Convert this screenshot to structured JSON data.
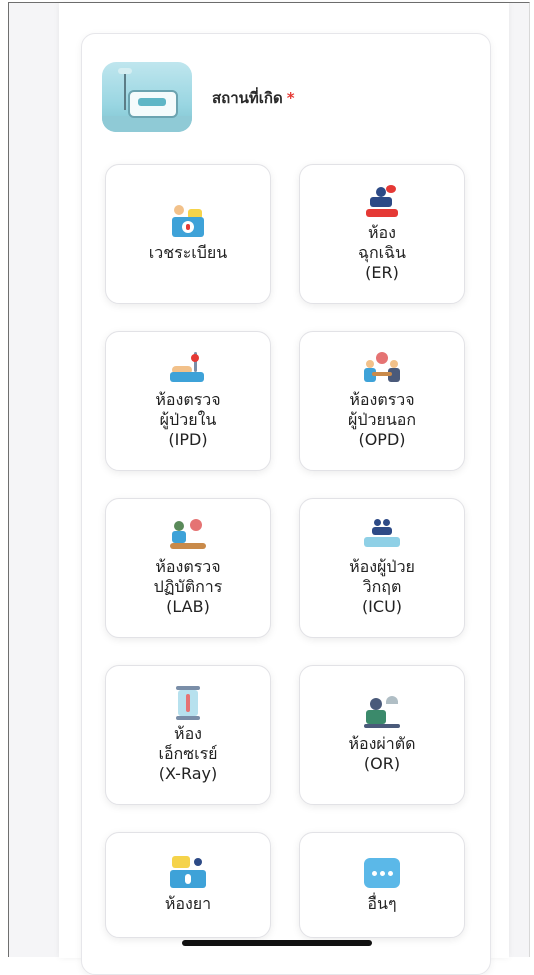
{
  "header": {
    "title": "สถานที่เกิด",
    "required_mark": "*"
  },
  "tiles": [
    {
      "lines": [
        "เวชระเบียน"
      ],
      "icon": "registration-desk-icon"
    },
    {
      "lines": [
        "ห้อง",
        "ฉุกเฉิน",
        "(ER)"
      ],
      "icon": "emergency-icon"
    },
    {
      "lines": [
        "ห้องตรวจ",
        "ผู้ป่วยใน",
        "(IPD)"
      ],
      "icon": "inpatient-icon"
    },
    {
      "lines": [
        "ห้องตรวจ",
        "ผู้ป่วยนอก",
        "(OPD)"
      ],
      "icon": "outpatient-icon"
    },
    {
      "lines": [
        "ห้องตรวจ",
        "ปฏิบัติการ",
        "(LAB)"
      ],
      "icon": "laboratory-icon"
    },
    {
      "lines": [
        "ห้องผู้ป่วย",
        "วิกฤต",
        "(ICU)"
      ],
      "icon": "icu-icon"
    },
    {
      "lines": [
        "ห้อง",
        "เอ็กซเรย์",
        "(X-Ray)"
      ],
      "icon": "xray-icon"
    },
    {
      "lines": [
        "ห้องผ่าตัด",
        "(OR)"
      ],
      "icon": "operating-room-icon"
    },
    {
      "lines": [
        "ห้องยา"
      ],
      "icon": "pharmacy-icon"
    },
    {
      "lines": [
        "อื่นๆ"
      ],
      "icon": "more-icon"
    }
  ],
  "colors": {
    "accent": "#5bb8e8",
    "required": "#e53935"
  }
}
